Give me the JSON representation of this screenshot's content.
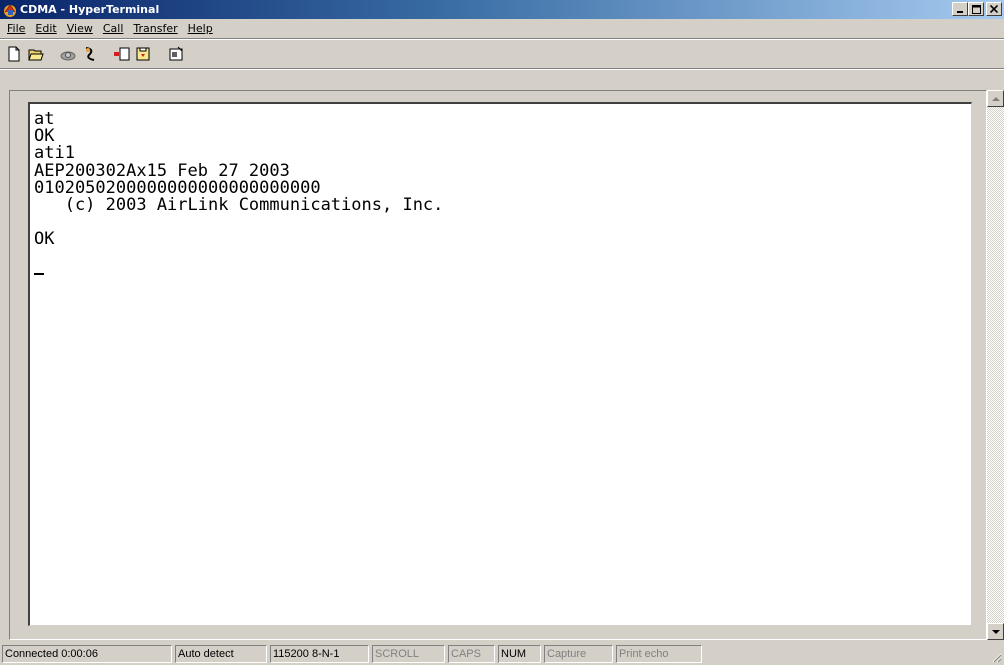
{
  "window": {
    "title": "CDMA - HyperTerminal",
    "controls": {
      "minimize": "_",
      "maximize": "□",
      "close": "×"
    }
  },
  "menu": {
    "items": [
      {
        "label": "File"
      },
      {
        "label": "Edit"
      },
      {
        "label": "View"
      },
      {
        "label": "Call"
      },
      {
        "label": "Transfer"
      },
      {
        "label": "Help"
      }
    ]
  },
  "toolbar": {
    "buttons": [
      "new-icon",
      "open-icon",
      "connect-icon",
      "disconnect-icon",
      "send-icon",
      "receive-icon",
      "properties-icon"
    ]
  },
  "terminal": {
    "lines": [
      "at",
      "OK",
      "ati1",
      "AEP200302Ax15 Feb 27 2003",
      "0102050200000000000000000000",
      "   (c) 2003 AirLink Communications, Inc.",
      "",
      "OK",
      ""
    ]
  },
  "statusbar": {
    "connected": "Connected 0:00:06",
    "detect": "Auto detect",
    "port_settings": "115200 8-N-1",
    "scroll": "SCROLL",
    "caps": "CAPS",
    "num": "NUM",
    "capture": "Capture",
    "print_echo": "Print echo"
  },
  "colors": {
    "title_gradient_start": "#0a246a",
    "title_gradient_end": "#a6caf0",
    "face": "#d4d0c8"
  }
}
